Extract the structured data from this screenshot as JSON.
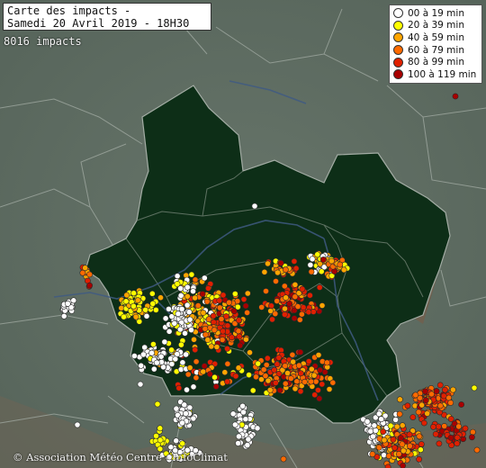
{
  "map": {
    "title_line1": "Carte des impacts -",
    "title_line2": "Samedi 20 Avril 2019 - 18H30",
    "impact_count": "8016 impacts",
    "copyright": "© Association Météo Centre - InfoClimat",
    "legend": [
      {
        "label": "00 à 19 min",
        "color": "#ffffff"
      },
      {
        "label": "20 à 39 min",
        "color": "#ffff00"
      },
      {
        "label": "40 à 59 min",
        "color": "#ffa500"
      },
      {
        "label": "60 à 79 min",
        "color": "#ff6a00"
      },
      {
        "label": "80 à 99 min",
        "color": "#e02000"
      },
      {
        "label": "100 à 119 min",
        "color": "#a80000"
      }
    ],
    "colors": {
      "background": "#5d6b5e",
      "region_fill": "#0d2e17",
      "boundary": "#9aa39b",
      "river": "#3f5a82"
    }
  }
}
